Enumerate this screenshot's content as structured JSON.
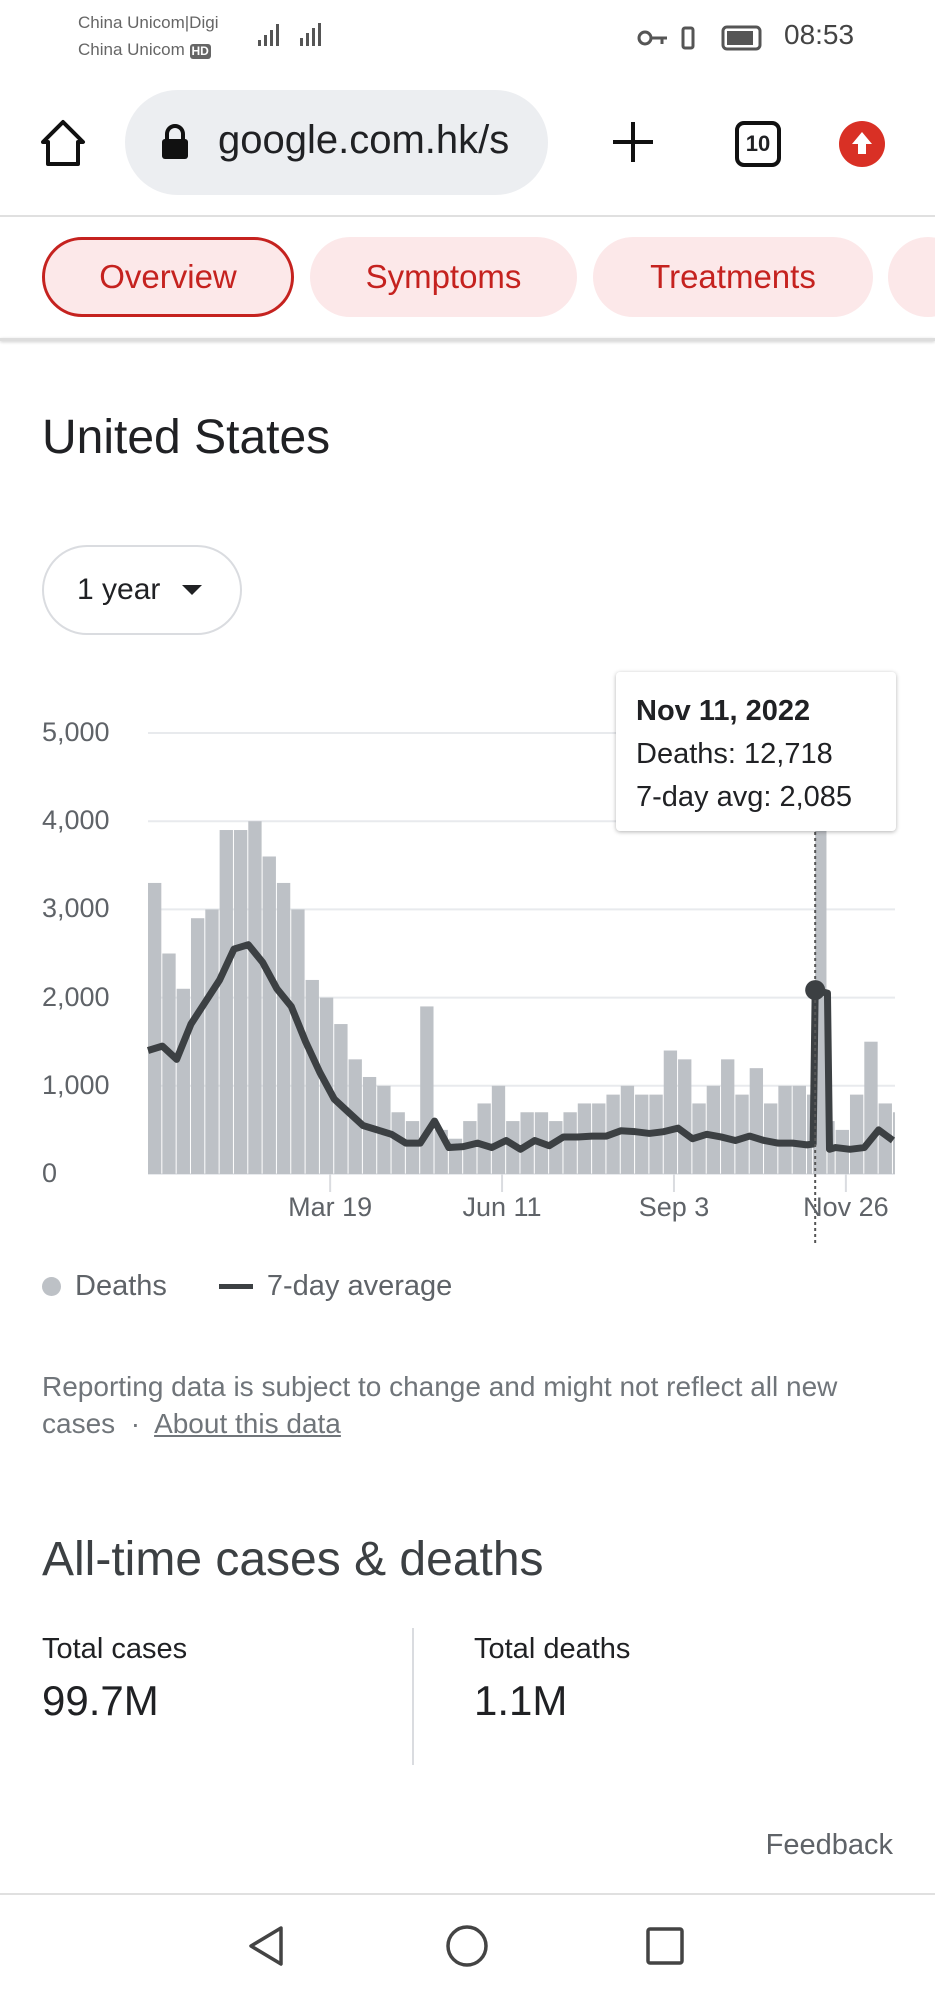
{
  "status_bar": {
    "carrier1": "China Unicom|Digi",
    "carrier2": "China Unicom",
    "hd": "HD",
    "time": "08:53"
  },
  "browser": {
    "url": "google.com.hk/s",
    "tab_count": "10"
  },
  "chips": [
    {
      "label": "Overview"
    },
    {
      "label": "Symptoms"
    },
    {
      "label": "Treatments"
    }
  ],
  "page_title": "United States",
  "range_select": {
    "selected": "1 year"
  },
  "tooltip": {
    "date": "Nov 11, 2022",
    "deaths": "Deaths: 12,718",
    "avg": "7-day avg: 2,085"
  },
  "legend": {
    "deaths": "Deaths",
    "avg": "7-day average"
  },
  "note": {
    "text": "Reporting data is subject to change and might not reflect all new cases",
    "sep": "·",
    "link": "About this data"
  },
  "all_time": {
    "heading": "All-time cases & deaths",
    "cases_label": "Total cases",
    "cases_value": "99.7M",
    "deaths_label": "Total deaths",
    "deaths_value": "1.1M"
  },
  "feedback": "Feedback",
  "colors": {
    "accent": "#c5221f",
    "chip_bg": "#fce8e9",
    "bars": "#bdc1c6",
    "line": "#3c4043"
  },
  "chart_data": {
    "type": "bar+line",
    "ylim": [
      0,
      5000
    ],
    "yticks": [
      "5,000",
      "4,000",
      "3,000",
      "2,000",
      "1,000",
      "0"
    ],
    "ytick_values": [
      5000,
      4000,
      3000,
      2000,
      1000,
      0
    ],
    "xticks": [
      "Mar 19",
      "Jun 11",
      "Sep 3",
      "Nov 26"
    ],
    "xtick_dates": [
      "2022-03-19",
      "2022-06-11",
      "2022-09-03",
      "2022-11-26"
    ],
    "xlim": [
      "2021-12-20",
      "2022-12-20"
    ],
    "grid": true,
    "legend_position": "bottom-left",
    "dates": [
      "2021-12-20",
      "2021-12-27",
      "2022-01-03",
      "2022-01-10",
      "2022-01-17",
      "2022-01-24",
      "2022-01-31",
      "2022-02-07",
      "2022-02-14",
      "2022-02-21",
      "2022-02-28",
      "2022-03-07",
      "2022-03-14",
      "2022-03-21",
      "2022-03-28",
      "2022-04-04",
      "2022-04-11",
      "2022-04-18",
      "2022-04-25",
      "2022-05-02",
      "2022-05-09",
      "2022-05-16",
      "2022-05-23",
      "2022-05-30",
      "2022-06-06",
      "2022-06-13",
      "2022-06-20",
      "2022-06-27",
      "2022-07-04",
      "2022-07-11",
      "2022-07-18",
      "2022-07-25",
      "2022-08-01",
      "2022-08-08",
      "2022-08-15",
      "2022-08-22",
      "2022-08-29",
      "2022-09-05",
      "2022-09-12",
      "2022-09-19",
      "2022-09-26",
      "2022-10-03",
      "2022-10-10",
      "2022-10-17",
      "2022-10-24",
      "2022-10-31",
      "2022-11-07",
      "2022-11-10",
      "2022-11-11",
      "2022-11-17",
      "2022-11-18",
      "2022-11-21",
      "2022-11-28",
      "2022-12-05",
      "2022-12-12",
      "2022-12-19"
    ],
    "series": [
      {
        "name": "Deaths",
        "values": [
          3300,
          2500,
          2100,
          2900,
          3000,
          3900,
          3900,
          4000,
          3600,
          3300,
          3000,
          2200,
          2000,
          1700,
          1300,
          1100,
          1000,
          700,
          600,
          1900,
          500,
          400,
          600,
          800,
          1000,
          600,
          700,
          700,
          600,
          700,
          800,
          800,
          900,
          1000,
          900,
          900,
          1400,
          1300,
          800,
          1000,
          1300,
          900,
          1200,
          800,
          1000,
          1000,
          900,
          600,
          12718,
          700,
          600,
          500,
          900,
          1500,
          800,
          700
        ]
      },
      {
        "name": "7-day average",
        "values": [
          1400,
          1450,
          1300,
          1700,
          1950,
          2200,
          2550,
          2600,
          2400,
          2100,
          1900,
          1500,
          1150,
          850,
          700,
          550,
          500,
          450,
          350,
          350,
          600,
          300,
          310,
          350,
          300,
          380,
          280,
          380,
          320,
          420,
          420,
          430,
          430,
          490,
          480,
          460,
          480,
          520,
          400,
          450,
          420,
          380,
          430,
          380,
          350,
          350,
          330,
          340,
          2085,
          2050,
          280,
          300,
          280,
          300,
          500,
          380
        ]
      }
    ],
    "highlight": {
      "date": "2022-11-11",
      "deaths": 12718,
      "avg": 2085
    }
  }
}
